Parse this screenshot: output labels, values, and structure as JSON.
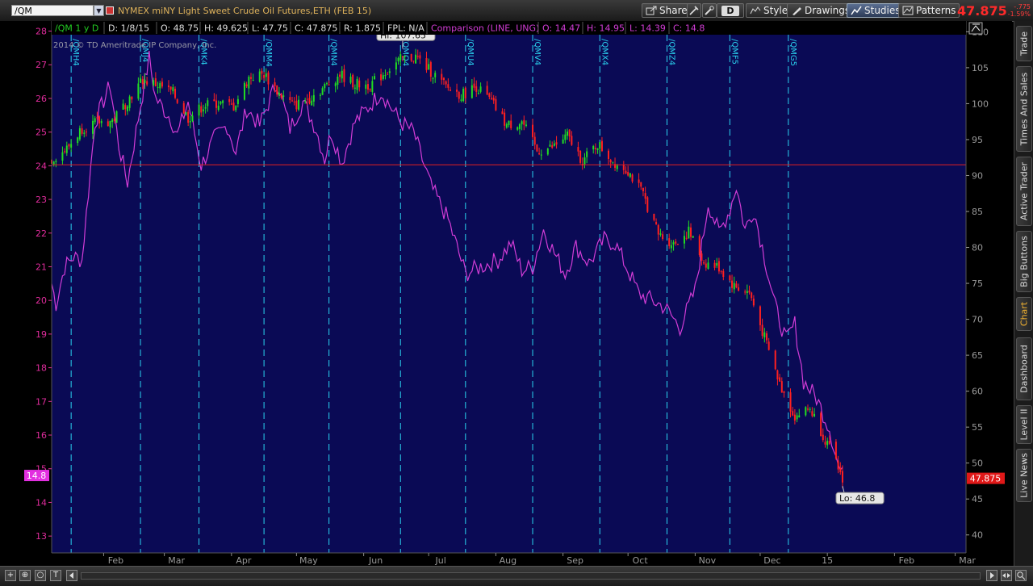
{
  "header": {
    "symbol": "/QM",
    "description": "NYMEX miNY Light Sweet Crude Oil Futures,ETH (FEB 15)",
    "last_price": "47.875",
    "change": "-.775",
    "change_pct": "-1.59%",
    "buttons": {
      "share": "Share",
      "d": "D",
      "style": "Style",
      "drawings": "Drawings",
      "studies": "Studies",
      "patterns": "Patterns"
    }
  },
  "info_bar": {
    "symbol_period": "/QM 1 y D",
    "date": "D: 1/8/15",
    "open": "O: 48.75",
    "high": "H: 49.625",
    "low": "L: 47.75",
    "close": "C: 47.875",
    "range": "R: 1.875",
    "fpl": "FPL: N/A",
    "comparison": "Comparison (LINE, UNG)",
    "cmp_open": "O: 14.47",
    "cmp_high": "H: 14.95",
    "cmp_low": "L: 14.39",
    "cmp_close": "C: 14.8"
  },
  "copyright": "2014 © TD Ameritrade IP Company, Inc.",
  "side_tabs": [
    "Trade",
    "Times And Sales",
    "Active Trader",
    "Big Buttons",
    "Chart",
    "Dashboard",
    "Level II",
    "Live News"
  ],
  "active_side_tab": "Chart",
  "bottom_buttons": [
    "+",
    "⊕",
    "○",
    "T"
  ],
  "chart_data": {
    "type": "line",
    "title": "NYMEX miNY Light Sweet Crude Oil Futures,ETH (FEB 15)",
    "background": "#0a0a55",
    "colors": {
      "up": "#22dd22",
      "down": "#ff2020",
      "comparison": "#d23cd6",
      "expiry": "#2ad4f0",
      "price_line": "#e02020",
      "left_axis": "#e02c9c",
      "right_axis": "#999999"
    },
    "left_axis": {
      "series": "UNG",
      "range": [
        12.5,
        28.3
      ],
      "ticks": [
        13,
        14,
        15,
        16,
        17,
        18,
        19,
        20,
        21,
        22,
        23,
        24,
        25,
        26,
        27,
        28
      ]
    },
    "right_axis": {
      "series": "/QM",
      "range": [
        37.5,
        111.5
      ],
      "ticks": [
        40,
        45,
        50,
        55,
        60,
        65,
        70,
        75,
        80,
        85,
        90,
        95,
        100,
        105,
        110
      ]
    },
    "x_labels": [
      "Feb",
      "Mar",
      "Apr",
      "May",
      "Jun",
      "Jul",
      "Aug",
      "Sep",
      "Oct",
      "Nov",
      "Dec",
      "15",
      "Feb",
      "Mar"
    ],
    "x_label_dates": [
      "2014-02-01",
      "2014-03-01",
      "2014-04-01",
      "2014-05-01",
      "2014-06-01",
      "2014-07-01",
      "2014-08-01",
      "2014-09-01",
      "2014-10-01",
      "2014-11-01",
      "2014-12-01",
      "2015-01-01",
      "2015-02-01",
      "2015-03-01"
    ],
    "x_range": [
      "2014-01-08",
      "2015-03-06"
    ],
    "expirations": [
      {
        "label": "/QMH4",
        "date": "2014-01-17"
      },
      {
        "label": "/QMJ4",
        "date": "2014-02-18"
      },
      {
        "label": "/QMK4",
        "date": "2014-03-17"
      },
      {
        "label": "/QMM4",
        "date": "2014-04-16"
      },
      {
        "label": "/QMN4",
        "date": "2014-05-16"
      },
      {
        "label": "/QMQ4",
        "date": "2014-06-18"
      },
      {
        "label": "/QMU4",
        "date": "2014-07-18"
      },
      {
        "label": "/QMV4",
        "date": "2014-08-18"
      },
      {
        "label": "/QMX4",
        "date": "2014-09-18"
      },
      {
        "label": "/QMZ4",
        "date": "2014-10-19"
      },
      {
        "label": "/QMF5",
        "date": "2014-11-17"
      },
      {
        "label": "/QMG5",
        "date": "2014-12-14"
      }
    ],
    "price_line": 91.5,
    "series": [
      {
        "name": "/QM",
        "axis": "right",
        "points": [
          [
            "2014-01-08",
            92.3
          ],
          [
            "2014-01-15",
            93.7
          ],
          [
            "2014-01-22",
            96.6
          ],
          [
            "2014-01-29",
            97.4
          ],
          [
            "2014-02-05",
            97.6
          ],
          [
            "2014-02-12",
            100.4
          ],
          [
            "2014-02-19",
            103.3
          ],
          [
            "2014-02-26",
            102.6
          ],
          [
            "2014-03-05",
            101.5
          ],
          [
            "2014-03-12",
            98.0
          ],
          [
            "2014-03-19",
            99.7
          ],
          [
            "2014-03-26",
            100.1
          ],
          [
            "2014-04-02",
            99.6
          ],
          [
            "2014-04-09",
            103.6
          ],
          [
            "2014-04-16",
            104.1
          ],
          [
            "2014-04-23",
            101.4
          ],
          [
            "2014-04-30",
            99.7
          ],
          [
            "2014-05-07",
            100.8
          ],
          [
            "2014-05-14",
            102.3
          ],
          [
            "2014-05-21",
            104.1
          ],
          [
            "2014-05-28",
            102.7
          ],
          [
            "2014-06-04",
            102.6
          ],
          [
            "2014-06-11",
            104.4
          ],
          [
            "2014-06-18",
            106.1
          ],
          [
            "2014-06-25",
            106.5
          ],
          [
            "2014-07-02",
            104.5
          ],
          [
            "2014-07-09",
            102.3
          ],
          [
            "2014-07-16",
            101.2
          ],
          [
            "2014-07-23",
            102.4
          ],
          [
            "2014-07-30",
            100.2
          ],
          [
            "2014-08-06",
            97.0
          ],
          [
            "2014-08-13",
            97.5
          ],
          [
            "2014-08-20",
            93.4
          ],
          [
            "2014-08-27",
            93.9
          ],
          [
            "2014-09-03",
            95.5
          ],
          [
            "2014-09-10",
            92.0
          ],
          [
            "2014-09-17",
            94.4
          ],
          [
            "2014-09-24",
            92.0
          ],
          [
            "2014-10-01",
            90.7
          ],
          [
            "2014-10-08",
            87.3
          ],
          [
            "2014-10-15",
            81.8
          ],
          [
            "2014-10-22",
            80.5
          ],
          [
            "2014-10-29",
            82.2
          ],
          [
            "2014-11-05",
            77.9
          ],
          [
            "2014-11-12",
            77.2
          ],
          [
            "2014-11-19",
            74.6
          ],
          [
            "2014-11-26",
            73.7
          ],
          [
            "2014-12-03",
            67.4
          ],
          [
            "2014-12-10",
            61.0
          ],
          [
            "2014-12-17",
            56.5
          ],
          [
            "2014-12-24",
            57.6
          ],
          [
            "2014-12-31",
            53.3
          ],
          [
            "2015-01-08",
            47.9
          ]
        ]
      },
      {
        "name": "UNG",
        "axis": "left",
        "points": [
          [
            "2014-01-08",
            20.5
          ],
          [
            "2014-01-10",
            19.9
          ],
          [
            "2014-01-14",
            21.0
          ],
          [
            "2014-01-18",
            21.3
          ],
          [
            "2014-01-22",
            21.2
          ],
          [
            "2014-01-28",
            25.3
          ],
          [
            "2014-02-04",
            26.4
          ],
          [
            "2014-02-08",
            24.6
          ],
          [
            "2014-02-12",
            23.5
          ],
          [
            "2014-02-18",
            25.8
          ],
          [
            "2014-02-22",
            27.2
          ],
          [
            "2014-02-25",
            26.0
          ],
          [
            "2014-03-04",
            25.4
          ],
          [
            "2014-03-07",
            24.9
          ],
          [
            "2014-03-12",
            25.9
          ],
          [
            "2014-03-18",
            24.0
          ],
          [
            "2014-03-24",
            24.8
          ],
          [
            "2014-03-30",
            25.2
          ],
          [
            "2014-04-03",
            24.4
          ],
          [
            "2014-04-08",
            25.7
          ],
          [
            "2014-04-14",
            25.2
          ],
          [
            "2014-04-22",
            26.5
          ],
          [
            "2014-04-28",
            25.1
          ],
          [
            "2014-05-04",
            25.9
          ],
          [
            "2014-05-10",
            25.1
          ],
          [
            "2014-05-14",
            24.2
          ],
          [
            "2014-05-17",
            25.0
          ],
          [
            "2014-05-22",
            24.1
          ],
          [
            "2014-05-28",
            25.3
          ],
          [
            "2014-06-04",
            25.8
          ],
          [
            "2014-06-09",
            26.2
          ],
          [
            "2014-06-13",
            25.8
          ],
          [
            "2014-06-18",
            25.3
          ],
          [
            "2014-06-24",
            25.0
          ],
          [
            "2014-07-02",
            23.4
          ],
          [
            "2014-07-10",
            22.4
          ],
          [
            "2014-07-18",
            20.8
          ],
          [
            "2014-07-25",
            21.0
          ],
          [
            "2014-08-02",
            21.2
          ],
          [
            "2014-08-08",
            21.7
          ],
          [
            "2014-08-13",
            20.9
          ],
          [
            "2014-08-18",
            21.0
          ],
          [
            "2014-08-23",
            22.1
          ],
          [
            "2014-08-28",
            21.4
          ],
          [
            "2014-09-02",
            20.8
          ],
          [
            "2014-09-07",
            21.6
          ],
          [
            "2014-09-13",
            21.1
          ],
          [
            "2014-09-20",
            21.8
          ],
          [
            "2014-09-25",
            21.7
          ],
          [
            "2014-10-01",
            20.9
          ],
          [
            "2014-10-06",
            20.2
          ],
          [
            "2014-10-12",
            20.0
          ],
          [
            "2014-10-18",
            19.8
          ],
          [
            "2014-10-25",
            19.2
          ],
          [
            "2014-11-01",
            20.3
          ],
          [
            "2014-11-07",
            22.9
          ],
          [
            "2014-11-12",
            22.0
          ],
          [
            "2014-11-17",
            22.7
          ],
          [
            "2014-11-20",
            23.4
          ],
          [
            "2014-11-24",
            22.1
          ],
          [
            "2014-11-28",
            22.7
          ],
          [
            "2014-12-03",
            21.3
          ],
          [
            "2014-12-08",
            19.8
          ],
          [
            "2014-12-13",
            18.8
          ],
          [
            "2014-12-17",
            19.3
          ],
          [
            "2014-12-21",
            17.6
          ],
          [
            "2014-12-27",
            17.1
          ],
          [
            "2015-01-02",
            16.2
          ],
          [
            "2015-01-06",
            15.1
          ],
          [
            "2015-01-08",
            14.8
          ]
        ]
      }
    ],
    "annotations": [
      {
        "text": "Hi: 107.65",
        "date": "2014-06-19",
        "value": 107.65,
        "axis": "right"
      },
      {
        "text": "Lo: 46.8",
        "date": "2015-01-08",
        "value": 46.8,
        "axis": "right"
      }
    ],
    "last_value_labels": {
      "left": "14.8",
      "right": "47.875"
    }
  }
}
